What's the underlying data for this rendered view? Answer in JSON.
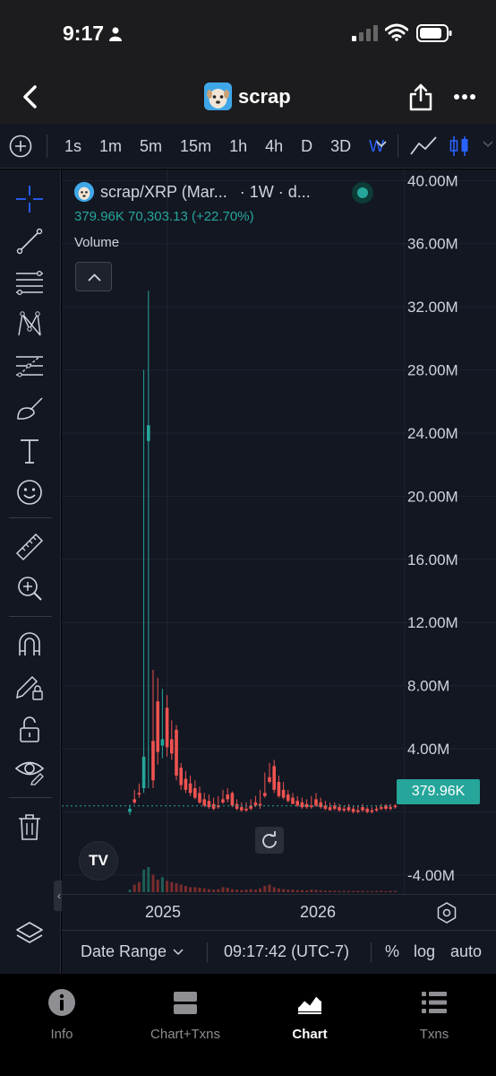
{
  "status_bar": {
    "time": "9:17"
  },
  "nav": {
    "title": "scrap"
  },
  "toolbar": {
    "intervals": [
      "1s",
      "1m",
      "5m",
      "15m",
      "1h",
      "4h",
      "D",
      "3D",
      "W"
    ],
    "active_interval": "W"
  },
  "legend": {
    "symbol": "scrap/XRP (Mar...",
    "interval": "· 1W · d...",
    "volume_line": "379.96K  70,303.13 (+22.70%)",
    "study": "Volume"
  },
  "price_axis": {
    "labels": [
      "40.00M",
      "36.00M",
      "32.00M",
      "28.00M",
      "24.00M",
      "20.00M",
      "16.00M",
      "12.00M",
      "8.00M",
      "4.00M",
      "-4.00M"
    ],
    "current_value": "379.96K"
  },
  "time_axis": {
    "labels": [
      "2025",
      "2026"
    ]
  },
  "chart_controls": {
    "date_range": "Date Range",
    "clock": "09:17:42 (UTC-7)",
    "percent": "%",
    "log": "log",
    "auto": "auto"
  },
  "tabs": [
    {
      "label": "Info",
      "icon": "info-icon"
    },
    {
      "label": "Chart+Txns",
      "icon": "split-view-icon"
    },
    {
      "label": "Chart",
      "icon": "chart-icon",
      "active": true
    },
    {
      "label": "Txns",
      "icon": "list-icon"
    }
  ],
  "colors": {
    "up": "#26a69a",
    "down": "#ef5350",
    "accent": "#2962ff",
    "background": "#131722"
  },
  "chart_data": {
    "type": "candlestick",
    "title": "",
    "ylim": [
      -5200000,
      40700000
    ],
    "y_ticks": [
      40000000,
      36000000,
      32000000,
      28000000,
      24000000,
      20000000,
      16000000,
      12000000,
      8000000,
      4000000,
      0,
      -4000000
    ],
    "x_ticks": [
      {
        "label": "2025",
        "index": 8
      },
      {
        "label": "2026",
        "index": 59
      }
    ],
    "candles": [
      [
        0,
        0.45,
        -0.2,
        0.2,
        0.8
      ],
      [
        0.8,
        1.4,
        0.5,
        0.6,
        1.2
      ],
      [
        1.2,
        1.8,
        0.9,
        1.1,
        1.5
      ],
      [
        1.5,
        28,
        1.2,
        3.5,
        23.5
      ],
      [
        23.5,
        33,
        1.5,
        24.5,
        4.5
      ],
      [
        4.5,
        9,
        1.5,
        2,
        7
      ],
      [
        7,
        8.5,
        3,
        3.8,
        4.2
      ],
      [
        4.2,
        7.8,
        3.4,
        4.6,
        6.6
      ],
      [
        6.6,
        7.4,
        3.5,
        4.1,
        4.6
      ],
      [
        4.6,
        5.8,
        3.3,
        3.7,
        5.2
      ],
      [
        5.2,
        5.5,
        2.0,
        2.3,
        2.8
      ],
      [
        2.8,
        3.1,
        1.4,
        1.7,
        2.1
      ],
      [
        2.1,
        2.6,
        1.2,
        1.4,
        1.8
      ],
      [
        1.8,
        2.3,
        1.0,
        1.2,
        1.5
      ],
      [
        1.5,
        2.0,
        0.8,
        0.9,
        1.2
      ],
      [
        1.2,
        1.6,
        0.5,
        0.6,
        0.8
      ],
      [
        0.8,
        1.2,
        0.3,
        0.4,
        0.7
      ],
      [
        0.7,
        1.1,
        0.2,
        0.3,
        0.5
      ],
      [
        0.5,
        0.9,
        0.1,
        0.2,
        0.4
      ],
      [
        0.4,
        1.0,
        0.2,
        0.3,
        0.8
      ],
      [
        0.8,
        1.4,
        0.5,
        0.6,
        1.1
      ],
      [
        1.1,
        1.5,
        0.6,
        0.8,
        1.2
      ],
      [
        1.2,
        1.3,
        0.3,
        0.4,
        0.5
      ],
      [
        0.5,
        0.8,
        0.1,
        0.2,
        0.3
      ],
      [
        0.3,
        0.6,
        0.0,
        0.1,
        0.2
      ],
      [
        0.2,
        0.6,
        0.0,
        0.1,
        0.4
      ],
      [
        0.4,
        0.8,
        0.1,
        0.2,
        0.6
      ],
      [
        0.6,
        1.0,
        0.3,
        0.4,
        0.5
      ],
      [
        0.5,
        1.4,
        0.2,
        0.4,
        1.2
      ],
      [
        1.2,
        2.5,
        0.9,
        1.0,
        2.2
      ],
      [
        2.2,
        3.1,
        1.8,
        1.9,
        2.9
      ],
      [
        2.9,
        3.3,
        1.2,
        1.4,
        1.9
      ],
      [
        1.9,
        2.3,
        0.9,
        1.0,
        1.4
      ],
      [
        1.4,
        1.9,
        0.8,
        0.9,
        1.1
      ],
      [
        1.1,
        1.4,
        0.6,
        0.7,
        0.9
      ],
      [
        0.9,
        1.2,
        0.5,
        0.5,
        0.7
      ],
      [
        0.7,
        1.0,
        0.3,
        0.4,
        0.6
      ],
      [
        0.6,
        0.9,
        0.2,
        0.3,
        0.5
      ],
      [
        0.5,
        0.8,
        0.2,
        0.3,
        0.4
      ],
      [
        0.4,
        1.0,
        0.2,
        0.3,
        0.8
      ],
      [
        0.8,
        1.2,
        0.3,
        0.4,
        0.6
      ],
      [
        0.6,
        0.9,
        0.2,
        0.3,
        0.4
      ],
      [
        0.4,
        0.7,
        0.1,
        0.2,
        0.3
      ],
      [
        0.3,
        0.6,
        0.1,
        0.1,
        0.4
      ],
      [
        0.4,
        0.6,
        0.1,
        0.2,
        0.3
      ],
      [
        0.3,
        0.5,
        0.0,
        0.1,
        0.2
      ],
      [
        0.2,
        0.4,
        0.0,
        0.1,
        0.3
      ],
      [
        0.3,
        0.5,
        0.0,
        0.1,
        0.2
      ],
      [
        0.2,
        0.4,
        -0.1,
        0.0,
        0.1
      ],
      [
        0.1,
        0.4,
        -0.1,
        0.0,
        0.3
      ],
      [
        0.3,
        0.5,
        0.0,
        0.1,
        0.2
      ],
      [
        0.2,
        0.3,
        -0.1,
        0.0,
        0.1
      ],
      [
        0.1,
        0.3,
        -0.1,
        0.0,
        0.2
      ],
      [
        0.2,
        0.4,
        0.0,
        0.1,
        0.3
      ],
      [
        0.3,
        0.5,
        0.1,
        0.2,
        0.4
      ],
      [
        0.4,
        0.5,
        0.1,
        0.2,
        0.3
      ],
      [
        0.3,
        0.5,
        0.1,
        0.2,
        0.4
      ],
      [
        0.4,
        0.5,
        0.2,
        0.3,
        0.38
      ]
    ],
    "candle_format": "open, high, low, close (millions)",
    "volume_relative": [
      0.1,
      0.3,
      0.4,
      0.9,
      1.0,
      0.7,
      0.5,
      0.6,
      0.45,
      0.4,
      0.35,
      0.3,
      0.25,
      0.2,
      0.2,
      0.18,
      0.15,
      0.12,
      0.1,
      0.12,
      0.2,
      0.18,
      0.12,
      0.1,
      0.08,
      0.1,
      0.12,
      0.1,
      0.15,
      0.25,
      0.3,
      0.2,
      0.15,
      0.12,
      0.1,
      0.1,
      0.08,
      0.08,
      0.07,
      0.1,
      0.09,
      0.07,
      0.06,
      0.06,
      0.06,
      0.05,
      0.05,
      0.05,
      0.04,
      0.05,
      0.05,
      0.04,
      0.04,
      0.05,
      0.05,
      0.04,
      0.05,
      0.05
    ],
    "last_value": 379960
  }
}
